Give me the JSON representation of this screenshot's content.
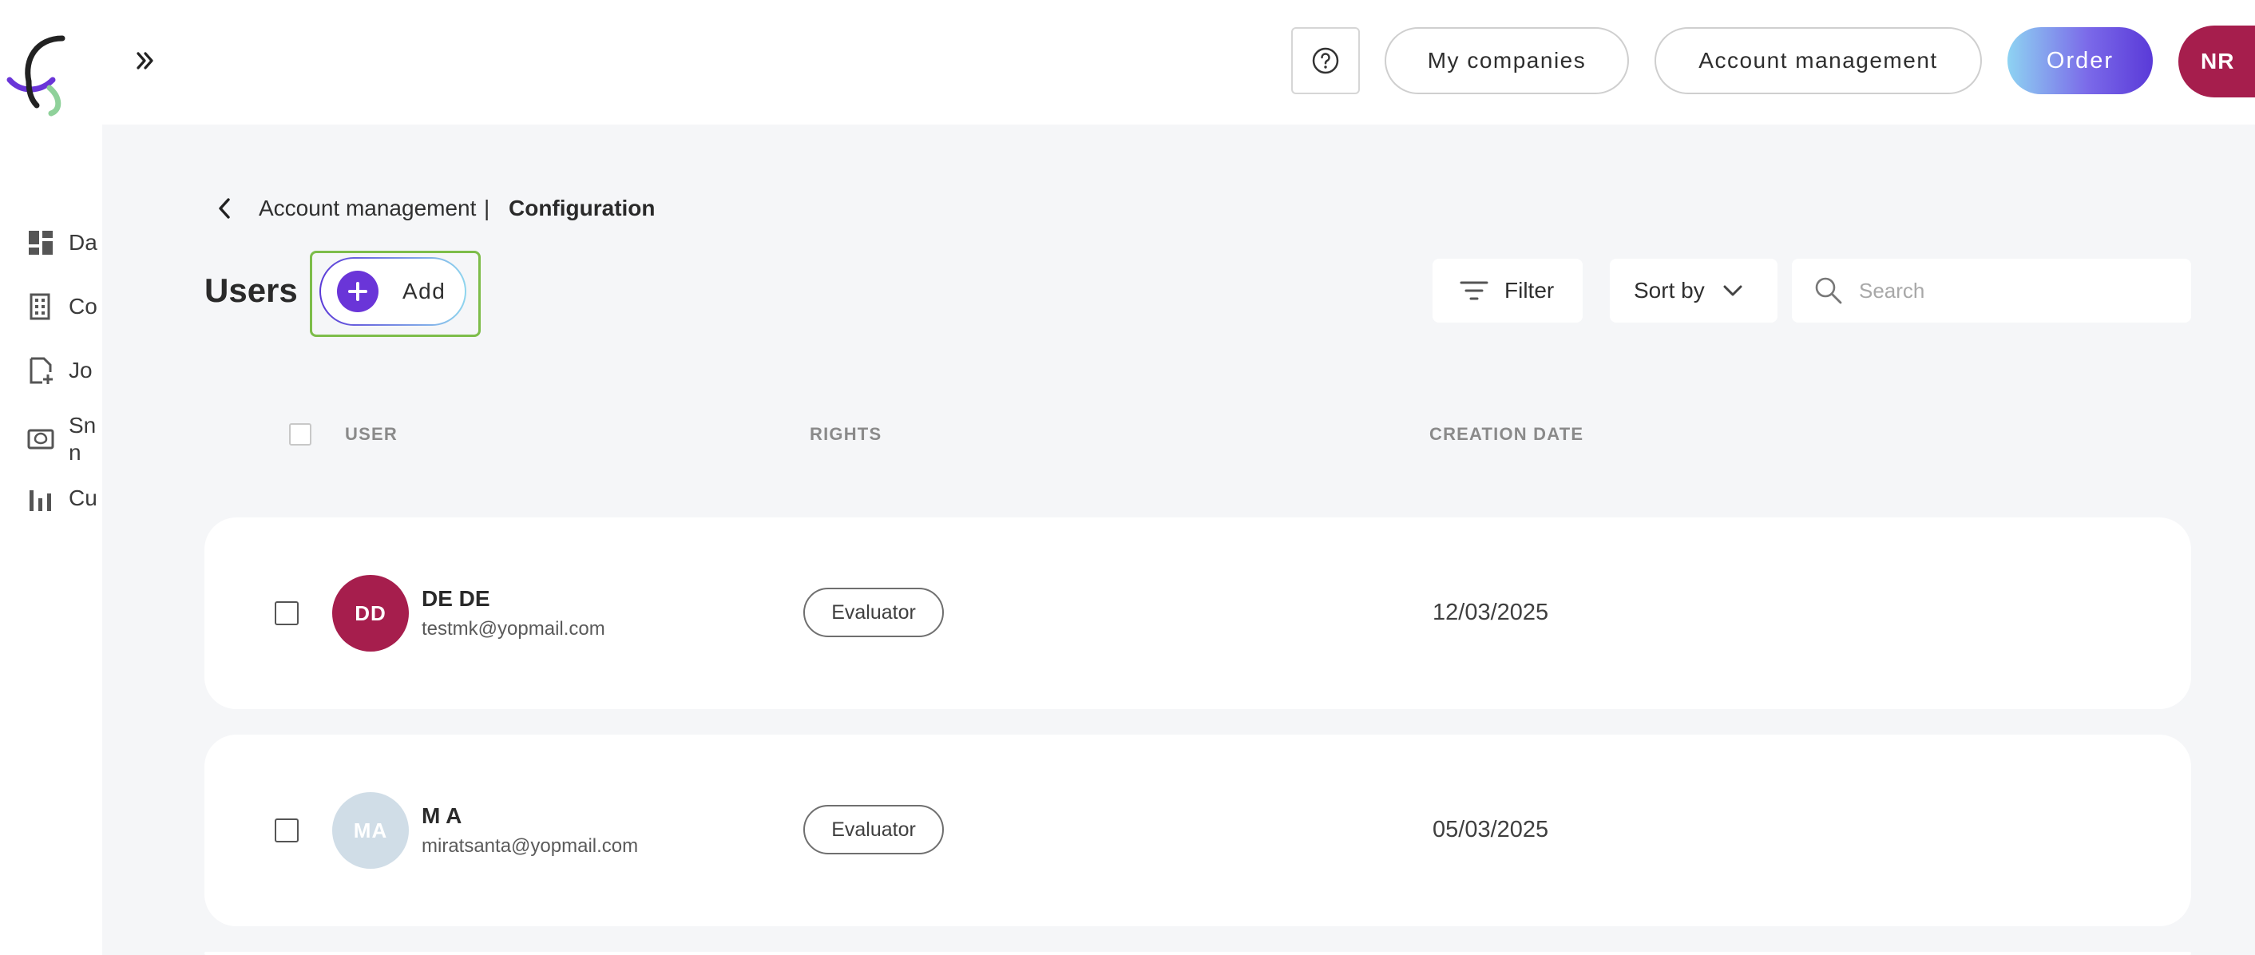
{
  "header": {
    "help_icon": "question-circle-icon",
    "my_companies": "My companies",
    "account_management": "Account management",
    "order": "Order",
    "user_initials": "NR",
    "colors": {
      "order_gradient_start": "#8ed3f2",
      "order_gradient_end": "#5a3ad8",
      "avatar": "#a61e4d"
    }
  },
  "sidebar": {
    "items": [
      {
        "label": "Da",
        "icon": "dashboard-icon"
      },
      {
        "label": "Co",
        "icon": "building-icon"
      },
      {
        "label": "Jo",
        "icon": "document-add-icon"
      },
      {
        "label": "Sn in",
        "icon": "screen-icon"
      },
      {
        "label": "Cu",
        "icon": "bar-chart-icon"
      }
    ]
  },
  "breadcrumb": {
    "parent": "Account management",
    "separator": "|",
    "current": "Configuration"
  },
  "page": {
    "title": "Users",
    "add_label": "Add",
    "filter_label": "Filter",
    "sort_label": "Sort by",
    "search_placeholder": "Search"
  },
  "table": {
    "columns": {
      "user": "USER",
      "rights": "RIGHTS",
      "creation_date": "CREATION DATE"
    },
    "rows": [
      {
        "initials": "DD",
        "name": "DE DE",
        "email": "testmk@yopmail.com",
        "rights": "Evaluator",
        "date": "12/03/2025",
        "avatar_color": "#a61e4d"
      },
      {
        "initials": "MA",
        "name": "M A",
        "email": "miratsanta@yopmail.com",
        "rights": "Evaluator",
        "date": "05/03/2025",
        "avatar_color": "#d0dde7"
      }
    ]
  }
}
